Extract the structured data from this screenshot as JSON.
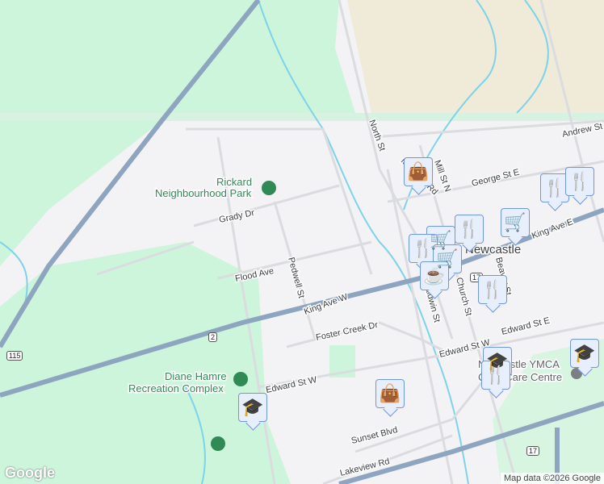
{
  "map": {
    "streets": [
      "North St",
      "Mill St N",
      "Andrew St",
      "George St E",
      "King Ave E",
      "King Ave W",
      "Pedwell St",
      "Flood Ave",
      "Grady Dr",
      "Foster Creek Dr",
      "Edward St W",
      "Edward St E",
      "Sunset Blvd",
      "Lakeview Rd",
      "Baldwin St",
      "Church St",
      "Beaver St",
      "Manvers Rd"
    ],
    "town": "Newcastle",
    "places": {
      "rickard": [
        "Rickard",
        "Neighbourhood Park"
      ],
      "diane": [
        "Diane Hamre",
        "Recreation Complex"
      ],
      "ymca": [
        "Newcastle YMCA",
        "Child Care Centre"
      ]
    },
    "shields": [
      "115",
      "2",
      "17",
      "17"
    ],
    "markers": [
      {
        "type": "shopping-bag",
        "icon": "👜"
      },
      {
        "type": "restaurant",
        "icon": "🍴"
      },
      {
        "type": "restaurant",
        "icon": "🍴"
      },
      {
        "type": "grocery",
        "icon": "🛒"
      },
      {
        "type": "restaurant",
        "icon": "🍴"
      },
      {
        "type": "grocery",
        "icon": "🛒"
      },
      {
        "type": "restaurant",
        "icon": "🍴"
      },
      {
        "type": "grocery",
        "icon": "🛒"
      },
      {
        "type": "cafe",
        "icon": "☕"
      },
      {
        "type": "restaurant",
        "icon": "🍴"
      },
      {
        "type": "school",
        "icon": "🎓"
      },
      {
        "type": "restaurant",
        "icon": "🍴"
      },
      {
        "type": "school",
        "icon": "🎓"
      },
      {
        "type": "shopping-bag",
        "icon": "👜"
      },
      {
        "type": "school",
        "icon": "🎓"
      }
    ],
    "attribution": "Map data ©2026 Google",
    "logo": "Google"
  }
}
